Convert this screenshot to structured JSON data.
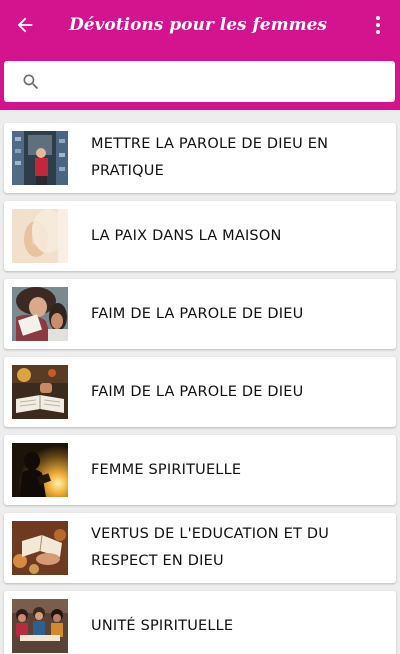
{
  "appbar": {
    "title": "Dévotions pour les femmes",
    "back_icon": "arrow-back-icon",
    "menu_icon": "more-vert-icon",
    "color": "#d4148e"
  },
  "search": {
    "placeholder": "",
    "value": "",
    "icon": "search-icon"
  },
  "items": [
    {
      "label": "METTRE LA PAROLE DE DIEU EN PRATIQUE"
    },
    {
      "label": "LA PAIX DANS LA MAISON"
    },
    {
      "label": "FAIM DE LA PAROLE DE DIEU"
    },
    {
      "label": "FAIM DE LA PAROLE DE DIEU"
    },
    {
      "label": "FEMME SPIRITUELLE"
    },
    {
      "label": "VERTUS DE L'EDUCATION ET DU RESPECT EN DIEU"
    },
    {
      "label": "UNITÉ SPIRITUELLE"
    }
  ]
}
